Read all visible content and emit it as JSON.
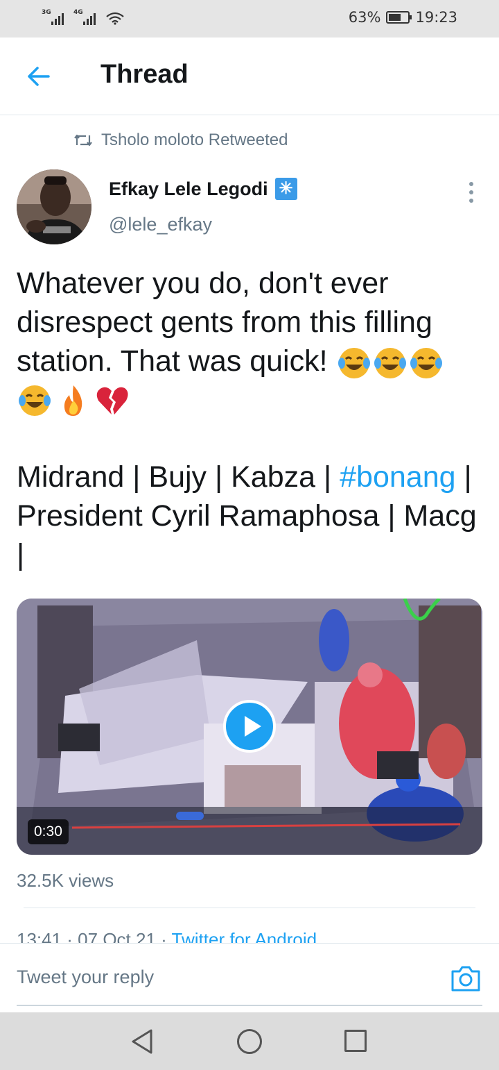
{
  "status_bar": {
    "network1": "3G",
    "network2": "4G",
    "battery_percent": "63%",
    "battery_level": 0.63,
    "time": "19:23"
  },
  "header": {
    "title": "Thread"
  },
  "retweet_context": {
    "text": "Tsholo moloto Retweeted",
    "icon": "retweet-icon"
  },
  "author": {
    "name": "Efkay Lele Legodi",
    "handle": "@lele_efkay",
    "badge_icon": "asterisk-badge-icon"
  },
  "tweet": {
    "line1": "Whatever you do, don't ever disrespect gents from this filling station. That was quick! ",
    "emojis": [
      "tears-of-joy",
      "tears-of-joy",
      "tears-of-joy",
      "tears-of-joy",
      "fire",
      "broken-heart"
    ],
    "line2_prefix": "Midrand | Bujy | Kabza | ",
    "hashtag": "#bonang",
    "line2_suffix": " | President Cyril Ramaphosa | Macg |"
  },
  "media": {
    "duration": "0:30",
    "type": "video"
  },
  "views": "32.5K views",
  "meta": {
    "timestamp": "13:41 · 07 Oct 21 · ",
    "source": "Twitter for Android"
  },
  "reply": {
    "placeholder": "Tweet your reply"
  },
  "colors": {
    "accent": "#1da1f2",
    "secondary_text": "#657786"
  }
}
